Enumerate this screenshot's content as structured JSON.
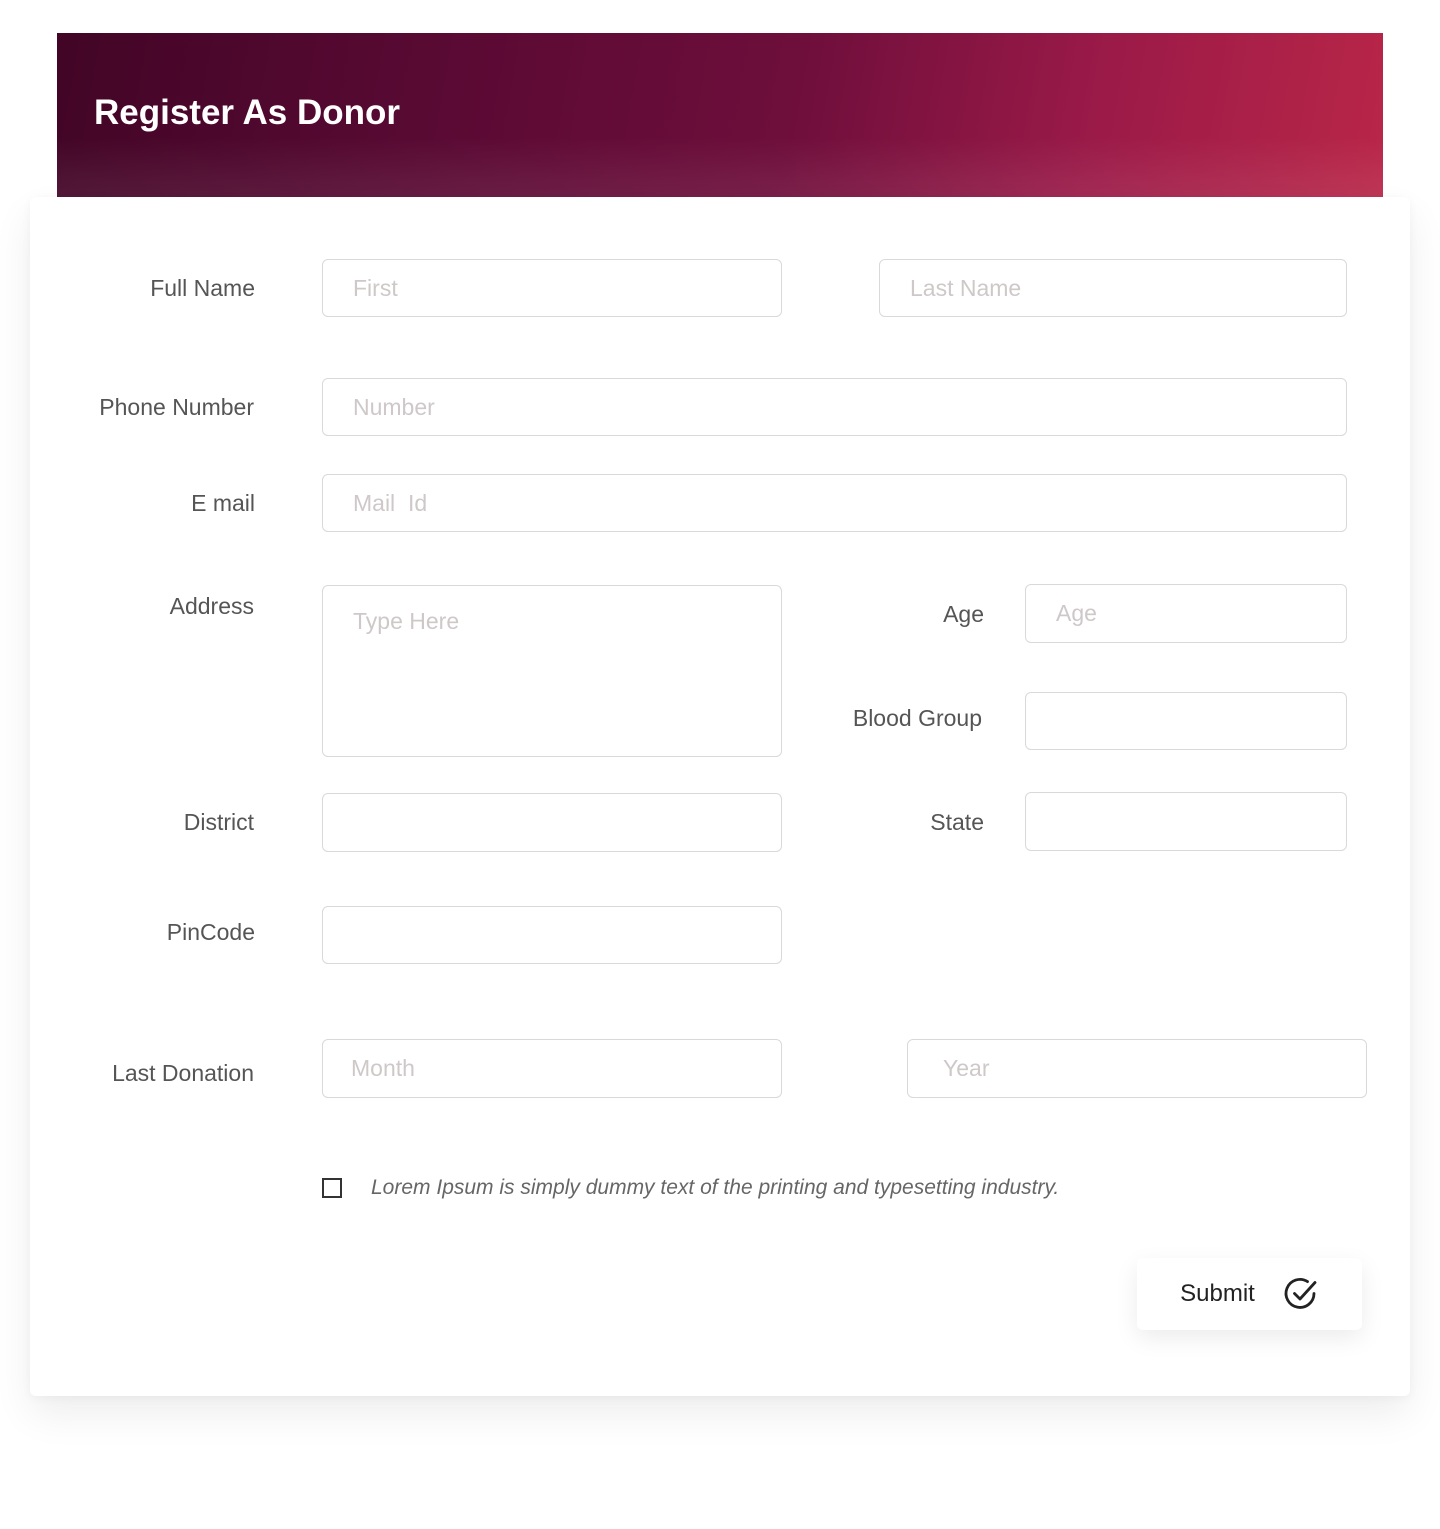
{
  "header": {
    "title": "Register As Donor"
  },
  "form": {
    "full_name": {
      "label": "Full Name",
      "first_placeholder": "First",
      "last_placeholder": "Last Name"
    },
    "phone": {
      "label": "Phone Number",
      "placeholder": "Number"
    },
    "email": {
      "label": "E mail",
      "placeholder": "Mail  Id"
    },
    "address": {
      "label": "Address",
      "placeholder": "Type Here"
    },
    "age": {
      "label": "Age",
      "placeholder": "Age"
    },
    "blood_group": {
      "label": "Blood Group",
      "placeholder": ""
    },
    "district": {
      "label": "District",
      "placeholder": ""
    },
    "state": {
      "label": "State",
      "placeholder": ""
    },
    "pincode": {
      "label": "PinCode",
      "placeholder": ""
    },
    "last_donation": {
      "label": "Last Donation",
      "month_placeholder": "Month",
      "year_placeholder": "Year"
    },
    "consent": {
      "text": "Lorem Ipsum is simply dummy text of the printing and typesetting industry.",
      "checked": false
    },
    "submit": {
      "label": "Submit",
      "icon": "check-circle-icon"
    }
  },
  "colors": {
    "header_gradient_start": "#420526",
    "header_gradient_end": "#b92648",
    "placeholder": "#cfc8c8",
    "label": "#555555"
  }
}
